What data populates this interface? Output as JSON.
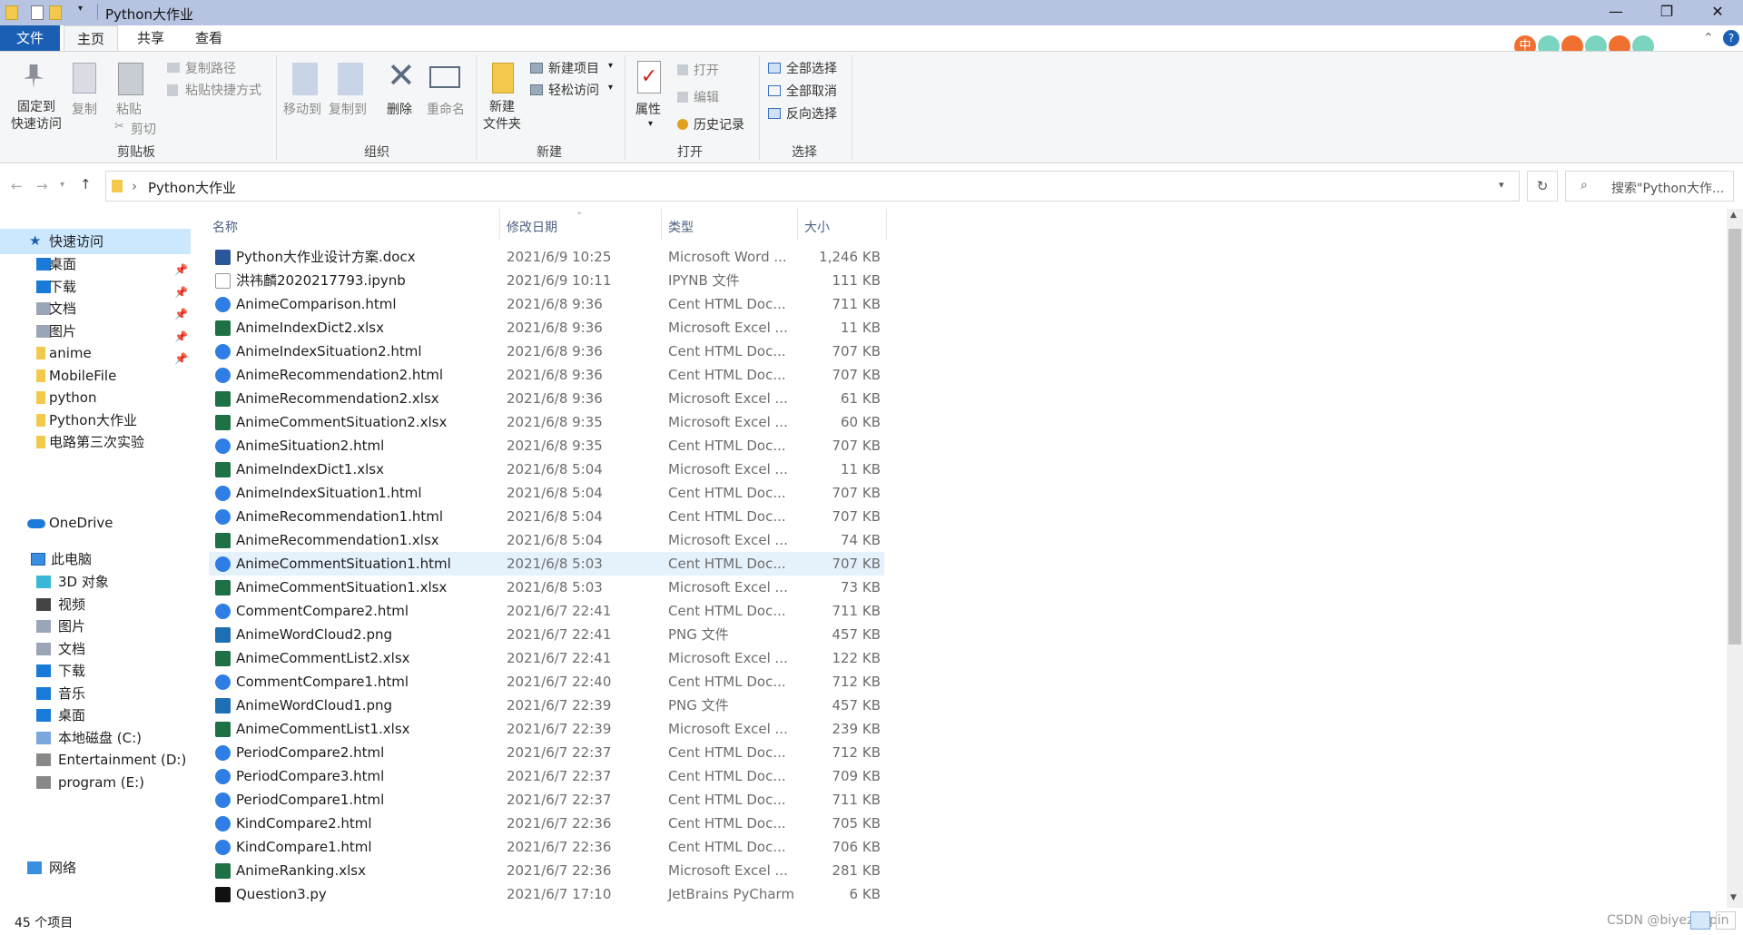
{
  "window": {
    "title": "Python大作业",
    "minimize": "—",
    "maximize": "❐",
    "close": "✕"
  },
  "menu": {
    "file": "文件",
    "home": "主页",
    "share": "共享",
    "view": "查看"
  },
  "ribbon": {
    "pin_quick": "固定到\n快速访问",
    "copy": "复制",
    "paste": "粘贴",
    "copy_path": "复制路径",
    "paste_shortcut": "粘贴快捷方式",
    "cut": "剪切",
    "group_clipboard": "剪贴板",
    "move_to": "移动到",
    "copy_to": "复制到",
    "delete": "删除",
    "rename": "重命名",
    "group_organize": "组织",
    "new_folder": "新建\n文件夹",
    "new_item": "新建项目",
    "easy_access": "轻松访问",
    "group_new": "新建",
    "properties": "属性",
    "open": "打开",
    "edit": "编辑",
    "history": "历史记录",
    "group_open": "打开",
    "select_all": "全部选择",
    "select_none": "全部取消",
    "invert_select": "反向选择",
    "group_select": "选择"
  },
  "address": {
    "path": "Python大作业",
    "search_placeholder": "搜索\"Python大作..."
  },
  "nav": {
    "quick_access": "快速访问",
    "quick_items": [
      "桌面",
      "下载",
      "文档",
      "图片",
      "anime",
      "MobileFile",
      "python",
      "Python大作业",
      "电路第三次实验"
    ],
    "onedrive": "OneDrive",
    "this_pc": "此电脑",
    "pc_items": [
      "3D 对象",
      "视频",
      "图片",
      "文档",
      "下载",
      "音乐",
      "桌面",
      "本地磁盘 (C:)",
      "Entertainment (D:)",
      "program (E:)"
    ],
    "network": "网络"
  },
  "columns": {
    "name": "名称",
    "date": "修改日期",
    "type": "类型",
    "size": "大小"
  },
  "files": [
    {
      "name": "Python大作业设计方案.docx",
      "date": "2021/6/9 10:25",
      "type": "Microsoft Word ...",
      "size": "1,246 KB",
      "icon": "word"
    },
    {
      "name": "洪祎麟2020217793.ipynb",
      "date": "2021/6/9 10:11",
      "type": "IPYNB 文件",
      "size": "111 KB",
      "icon": "blank"
    },
    {
      "name": "AnimeComparison.html",
      "date": "2021/6/8 9:36",
      "type": "Cent HTML Doc...",
      "size": "711 KB",
      "icon": "html"
    },
    {
      "name": "AnimeIndexDict2.xlsx",
      "date": "2021/6/8 9:36",
      "type": "Microsoft Excel ...",
      "size": "11 KB",
      "icon": "excel"
    },
    {
      "name": "AnimeIndexSituation2.html",
      "date": "2021/6/8 9:36",
      "type": "Cent HTML Doc...",
      "size": "707 KB",
      "icon": "html"
    },
    {
      "name": "AnimeRecommendation2.html",
      "date": "2021/6/8 9:36",
      "type": "Cent HTML Doc...",
      "size": "707 KB",
      "icon": "html"
    },
    {
      "name": "AnimeRecommendation2.xlsx",
      "date": "2021/6/8 9:36",
      "type": "Microsoft Excel ...",
      "size": "61 KB",
      "icon": "excel"
    },
    {
      "name": "AnimeCommentSituation2.xlsx",
      "date": "2021/6/8 9:35",
      "type": "Microsoft Excel ...",
      "size": "60 KB",
      "icon": "excel"
    },
    {
      "name": "AnimeSituation2.html",
      "date": "2021/6/8 9:35",
      "type": "Cent HTML Doc...",
      "size": "707 KB",
      "icon": "html"
    },
    {
      "name": "AnimeIndexDict1.xlsx",
      "date": "2021/6/8 5:04",
      "type": "Microsoft Excel ...",
      "size": "11 KB",
      "icon": "excel"
    },
    {
      "name": "AnimeIndexSituation1.html",
      "date": "2021/6/8 5:04",
      "type": "Cent HTML Doc...",
      "size": "707 KB",
      "icon": "html"
    },
    {
      "name": "AnimeRecommendation1.html",
      "date": "2021/6/8 5:04",
      "type": "Cent HTML Doc...",
      "size": "707 KB",
      "icon": "html"
    },
    {
      "name": "AnimeRecommendation1.xlsx",
      "date": "2021/6/8 5:04",
      "type": "Microsoft Excel ...",
      "size": "74 KB",
      "icon": "excel"
    },
    {
      "name": "AnimeCommentSituation1.html",
      "date": "2021/6/8 5:03",
      "type": "Cent HTML Doc...",
      "size": "707 KB",
      "icon": "html",
      "selected": true
    },
    {
      "name": "AnimeCommentSituation1.xlsx",
      "date": "2021/6/8 5:03",
      "type": "Microsoft Excel ...",
      "size": "73 KB",
      "icon": "excel"
    },
    {
      "name": "CommentCompare2.html",
      "date": "2021/6/7 22:41",
      "type": "Cent HTML Doc...",
      "size": "711 KB",
      "icon": "html"
    },
    {
      "name": "AnimeWordCloud2.png",
      "date": "2021/6/7 22:41",
      "type": "PNG 文件",
      "size": "457 KB",
      "icon": "png"
    },
    {
      "name": "AnimeCommentList2.xlsx",
      "date": "2021/6/7 22:41",
      "type": "Microsoft Excel ...",
      "size": "122 KB",
      "icon": "excel"
    },
    {
      "name": "CommentCompare1.html",
      "date": "2021/6/7 22:40",
      "type": "Cent HTML Doc...",
      "size": "712 KB",
      "icon": "html"
    },
    {
      "name": "AnimeWordCloud1.png",
      "date": "2021/6/7 22:39",
      "type": "PNG 文件",
      "size": "457 KB",
      "icon": "png"
    },
    {
      "name": "AnimeCommentList1.xlsx",
      "date": "2021/6/7 22:39",
      "type": "Microsoft Excel ...",
      "size": "239 KB",
      "icon": "excel"
    },
    {
      "name": "PeriodCompare2.html",
      "date": "2021/6/7 22:37",
      "type": "Cent HTML Doc...",
      "size": "712 KB",
      "icon": "html"
    },
    {
      "name": "PeriodCompare3.html",
      "date": "2021/6/7 22:37",
      "type": "Cent HTML Doc...",
      "size": "709 KB",
      "icon": "html"
    },
    {
      "name": "PeriodCompare1.html",
      "date": "2021/6/7 22:37",
      "type": "Cent HTML Doc...",
      "size": "711 KB",
      "icon": "html"
    },
    {
      "name": "KindCompare2.html",
      "date": "2021/6/7 22:36",
      "type": "Cent HTML Doc...",
      "size": "705 KB",
      "icon": "html"
    },
    {
      "name": "KindCompare1.html",
      "date": "2021/6/7 22:36",
      "type": "Cent HTML Doc...",
      "size": "706 KB",
      "icon": "html"
    },
    {
      "name": "AnimeRanking.xlsx",
      "date": "2021/6/7 22:36",
      "type": "Microsoft Excel ...",
      "size": "281 KB",
      "icon": "excel"
    },
    {
      "name": "Question3.py",
      "date": "2021/6/7 17:10",
      "type": "JetBrains PyCharm",
      "size": "6 KB",
      "icon": "pycharm"
    }
  ],
  "status": {
    "count": "45 个项目"
  },
  "watermark": "CSDN @biyezuopin",
  "colors": {
    "accent": "#1a5fb4",
    "titlebar": "#b7c4e1",
    "selected_row": "#e5f1fb",
    "html_icon": "#2f7ee6",
    "excel_icon": "#1e7145",
    "word_icon": "#2b579a"
  }
}
